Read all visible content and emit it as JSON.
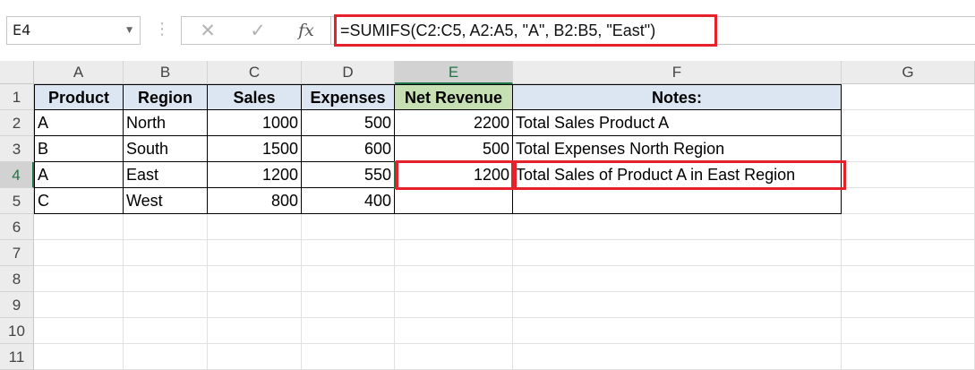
{
  "name_box": "E4",
  "formula_bar": {
    "cancel_symbol": "✕",
    "enter_symbol": "✓",
    "fx_label": "fx",
    "formula": "=SUMIFS(C2:C5, A2:A5, \"A\", B2:B5, \"East\")"
  },
  "columns": [
    "A",
    "B",
    "C",
    "D",
    "E",
    "F",
    "G"
  ],
  "rows": [
    "1",
    "2",
    "3",
    "4",
    "5",
    "6",
    "7",
    "8",
    "9",
    "10",
    "11"
  ],
  "table": {
    "headers": [
      "Product",
      "Region",
      "Sales",
      "Expenses",
      "Net Revenue",
      "Notes:"
    ],
    "data": [
      [
        "A",
        "North",
        "1000",
        "500",
        "2200",
        "Total Sales Product A"
      ],
      [
        "B",
        "South",
        "1500",
        "600",
        "500",
        "Total Expenses North Region"
      ],
      [
        "A",
        "East",
        "1200",
        "550",
        "1200",
        "Total Sales of Product A in East Region"
      ],
      [
        "C",
        "West",
        "800",
        "400",
        "",
        ""
      ]
    ]
  },
  "active_cell": "E4",
  "colors": {
    "accent": "#217346",
    "highlight": "#e8202c",
    "header_fill": "#dce6f2",
    "net_revenue_fill": "#c6e0b4"
  }
}
